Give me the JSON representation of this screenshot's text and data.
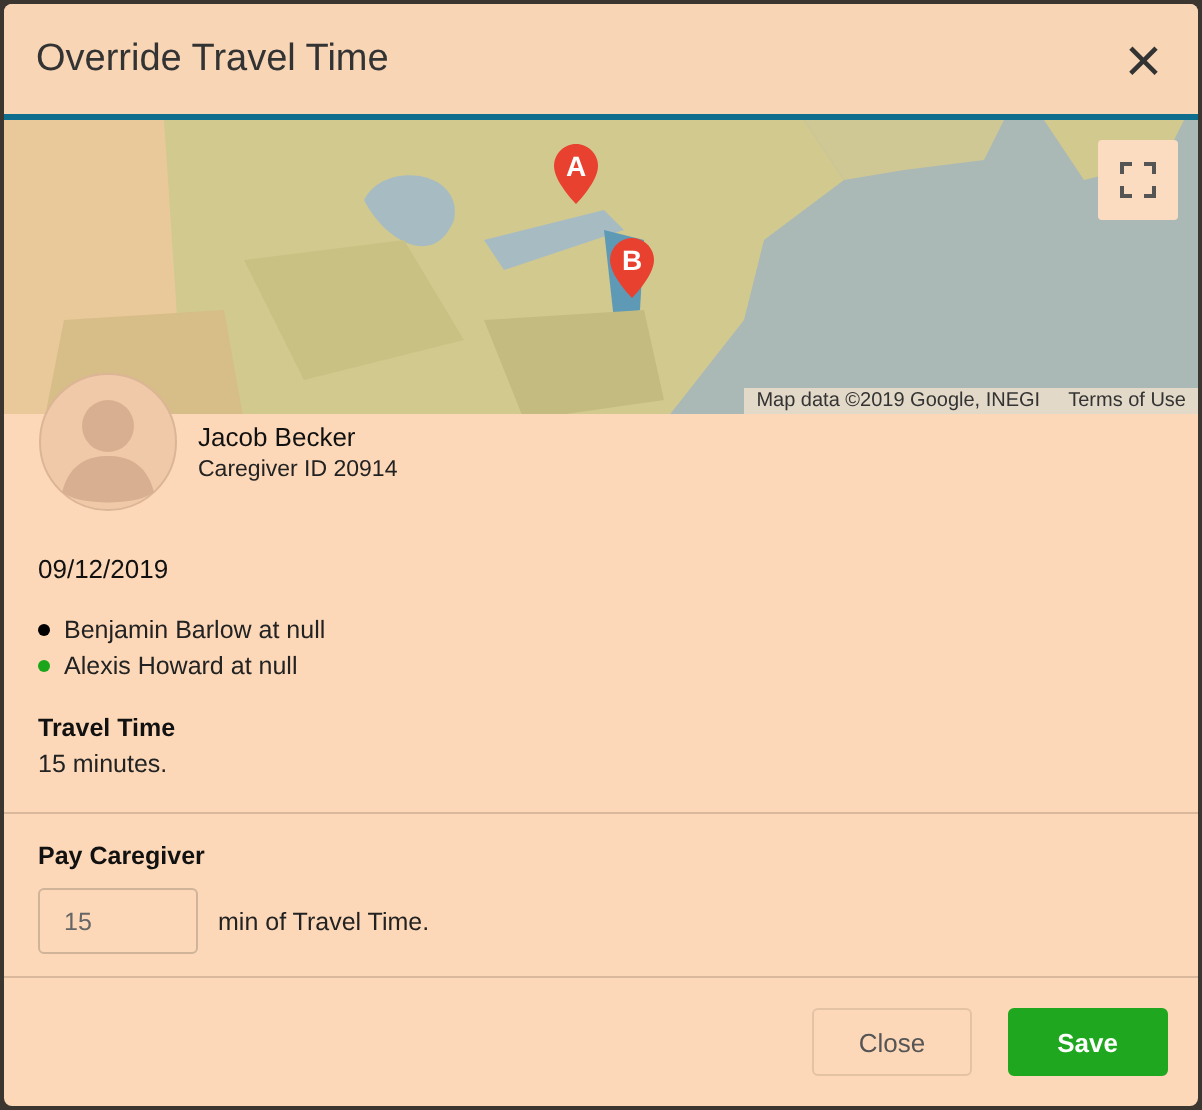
{
  "dialog": {
    "title": "Override Travel Time",
    "close_label": "×"
  },
  "map": {
    "kind": "picture",
    "markers": [
      {
        "label": "A"
      },
      {
        "label": "B"
      }
    ],
    "attribution": "Map data ©2019 Google, INEGI",
    "terms": "Terms of Use"
  },
  "caregiver": {
    "name": "Jacob Becker",
    "id_text": "Caregiver ID 20914"
  },
  "date": "09/12/2019",
  "visits": [
    {
      "text": "Benjamin Barlow at null",
      "color": "#000000"
    },
    {
      "text": "Alexis Howard at null",
      "color": "#1aa51a"
    }
  ],
  "travel": {
    "label": "Travel Time",
    "value": "15 minutes."
  },
  "pay": {
    "label": "Pay Caregiver",
    "input_value": "15",
    "suffix": "min of Travel Time."
  },
  "buttons": [
    {
      "label": "Close",
      "kind": "secondary"
    },
    {
      "label": "Save",
      "kind": "primary"
    }
  ]
}
